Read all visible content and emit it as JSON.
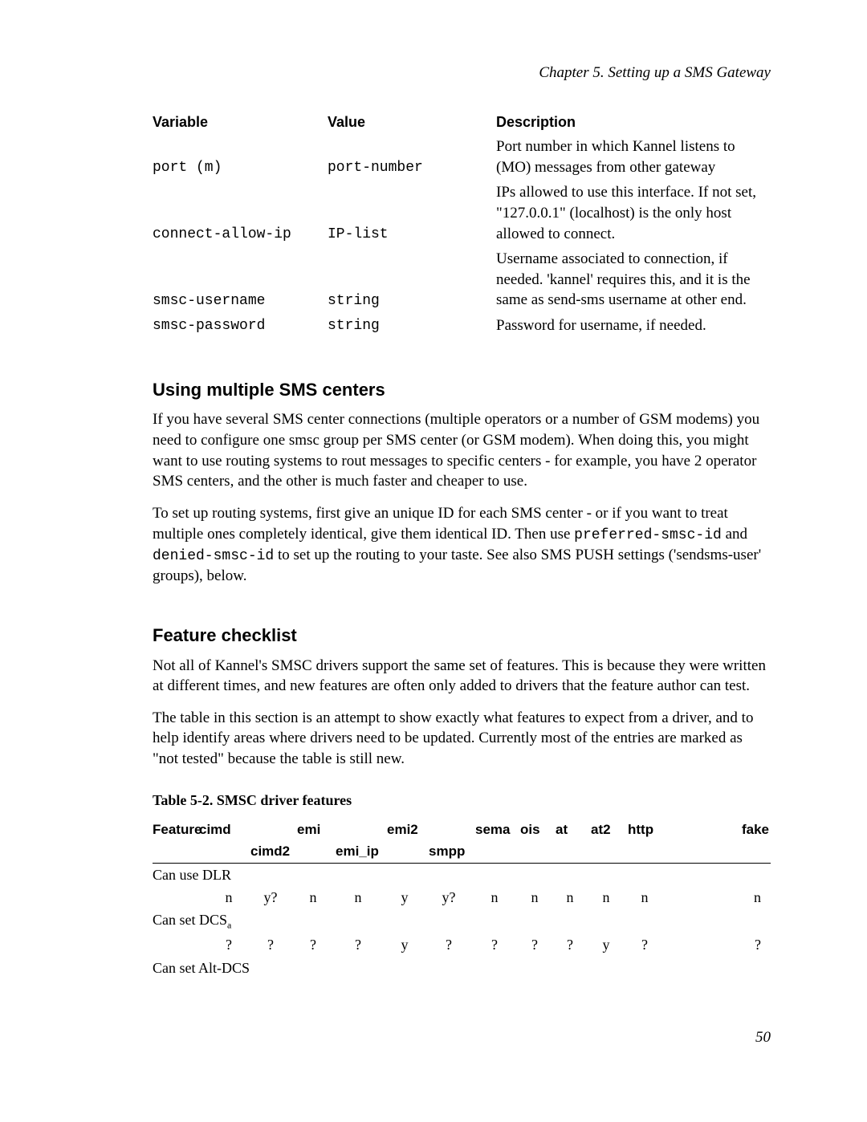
{
  "chapter_line": "Chapter 5. Setting up a SMS Gateway",
  "defs": {
    "headers": {
      "variable": "Variable",
      "value": "Value",
      "description": "Description"
    },
    "rows": [
      {
        "variable": "port (m)",
        "value": "port-number",
        "description": "Port number in which Kannel listens to (MO) messages from other gateway"
      },
      {
        "variable": "connect-allow-ip",
        "value": "IP-list",
        "description": "IPs allowed to use this interface. If not set, \"127.0.0.1\" (localhost) is the only host allowed to connect."
      },
      {
        "variable": "smsc-username",
        "value": "string",
        "description": "Username associated to connection, if needed. 'kannel' requires this, and it is the same as send-sms username at other end."
      },
      {
        "variable": "smsc-password",
        "value": "string",
        "description": "Password for username, if needed."
      }
    ]
  },
  "section1": {
    "title": "Using multiple SMS centers",
    "para1_a": "If you have several SMS center connections (multiple operators or a number of GSM modems) you need to configure one smsc group per SMS center (or GSM modem). When doing this, you might want to use routing systems to rout messages to specific centers - for example, you have 2 operator SMS centers, and the other is much faster and cheaper to use.",
    "para2_a": "To set up routing systems, first give an unique ID for each SMS center - or if you want to treat multiple ones completely identical, give them identical ID. Then use ",
    "para2_code1": "preferred-smsc-id",
    "para2_b": " and ",
    "para2_code2": "denied-smsc-id",
    "para2_c": " to set up the routing to your taste. See also SMS PUSH settings ('sendsms-user' groups), below."
  },
  "section2": {
    "title": "Feature checklist",
    "para1": "Not all of Kannel's SMSC drivers support the same set of features. This is because they were written at different times, and new features are often only added to drivers that the feature author can test.",
    "para2": "The table in this section is an attempt to show exactly what features to expect from a driver, and to help identify areas where drivers need to be updated. Currently most of the entries are marked as \"not tested\" because the table is still new."
  },
  "table52": {
    "caption": "Table 5-2. SMSC driver features",
    "headers": {
      "feature": "Feature",
      "cimd": "cimd",
      "cimd2": "cimd2",
      "emi": "emi",
      "emi_ip": "emi_ip",
      "emi2": "emi2",
      "smpp": "smpp",
      "sema": "sema",
      "ois": "ois",
      "at": "at",
      "at2": "at2",
      "http": "http",
      "fake": "fake"
    },
    "rows": [
      {
        "feature": "Can use DLR",
        "cells": [
          "n",
          "y?",
          "n",
          "n",
          "y",
          "y?",
          "n",
          "n",
          "n",
          "n",
          "n",
          "n"
        ]
      },
      {
        "feature_html": "Can set DCS",
        "feature_sub": "a",
        "cells": [
          "?",
          "?",
          "?",
          "?",
          "y",
          "?",
          "?",
          "?",
          "?",
          "y",
          "?",
          "?"
        ]
      },
      {
        "feature": "Can set Alt-DCS",
        "cells": []
      }
    ]
  },
  "page_number": "50"
}
